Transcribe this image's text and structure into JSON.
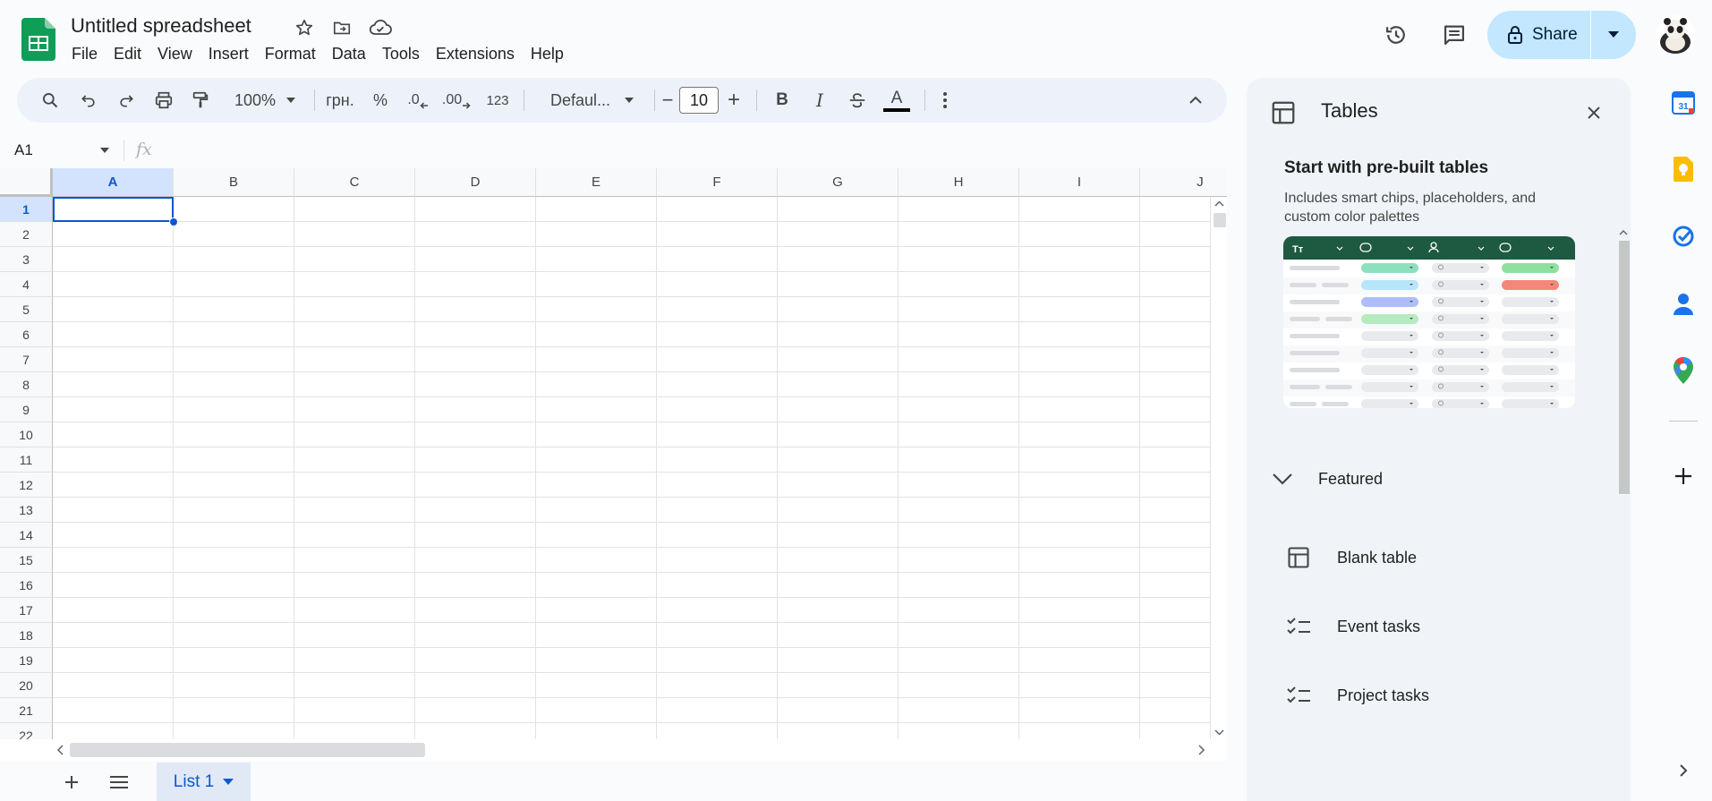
{
  "header": {
    "title": "Untitled spreadsheet",
    "menu": [
      "File",
      "Edit",
      "View",
      "Insert",
      "Format",
      "Data",
      "Tools",
      "Extensions",
      "Help"
    ],
    "share_label": "Share"
  },
  "toolbar": {
    "zoom": "100%",
    "currency": "грн.",
    "percent": "%",
    "dec_decrease": ".0",
    "dec_increase": ".00",
    "number_format": "123",
    "font": "Defaul...",
    "font_size": "10",
    "minus": "−",
    "plus": "+",
    "bold": "B",
    "italic": "I",
    "text_color": "A"
  },
  "formula_bar": {
    "cell_ref": "A1",
    "fx": "fx"
  },
  "grid": {
    "columns": [
      "A",
      "B",
      "C",
      "D",
      "E",
      "F",
      "G",
      "H",
      "I",
      "J"
    ],
    "rows": [
      "1",
      "2",
      "3",
      "4",
      "5",
      "6",
      "7",
      "8",
      "9",
      "10",
      "11",
      "12",
      "13",
      "14",
      "15",
      "16",
      "17",
      "18",
      "19",
      "20",
      "21",
      "22"
    ]
  },
  "sheets": {
    "active": "List 1"
  },
  "panel": {
    "title": "Tables",
    "subtitle": "Start with pre-built tables",
    "description": "Includes smart chips, placeholders, and custom color palettes",
    "preview_header": "Tт",
    "section": "Featured",
    "items": [
      "Blank table",
      "Event tasks",
      "Project tasks"
    ]
  },
  "rail": {
    "calendar_day": "31"
  },
  "colors": {
    "accent": "#0b57d0",
    "share_bg": "#c2e7ff",
    "sheets_green": "#0f9d58",
    "preview_header": "#1e5a41"
  }
}
